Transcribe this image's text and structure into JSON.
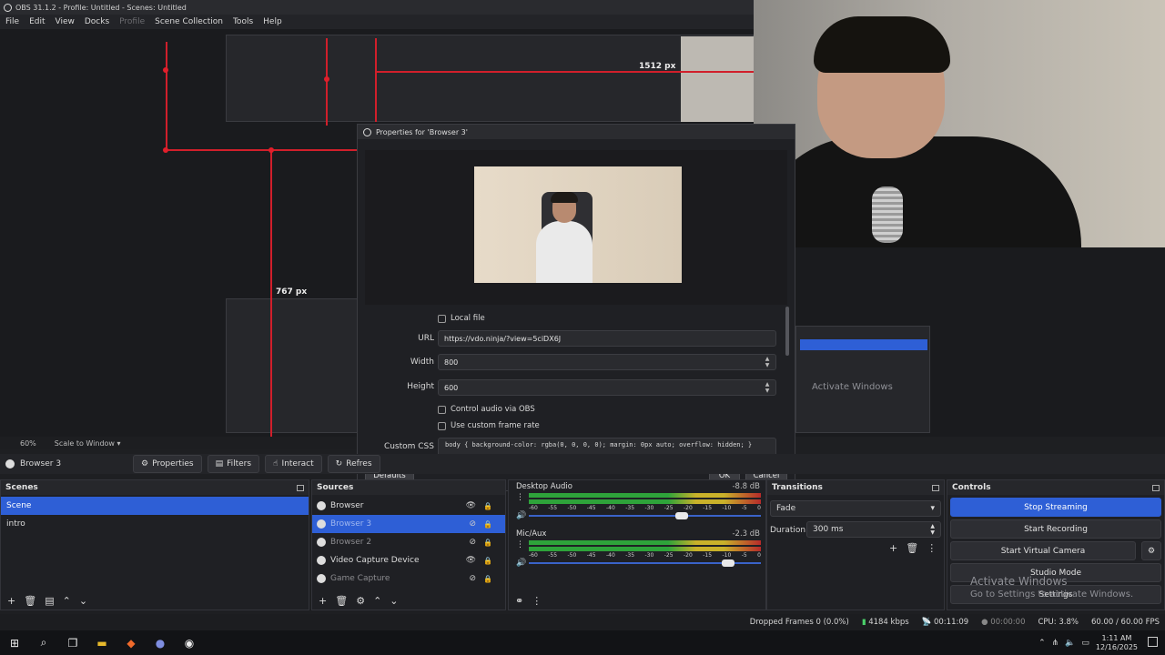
{
  "window": {
    "title": "OBS 31.1.2 - Profile: Untitled - Scenes: Untitled"
  },
  "menu": [
    "File",
    "Edit",
    "View",
    "Docks",
    "Profile",
    "Scene Collection",
    "Tools",
    "Help"
  ],
  "preview": {
    "label_width": "1512 px",
    "label_height": "767 px",
    "zoom": "60%",
    "scale_mode": "Scale to Window"
  },
  "props": {
    "title": "Properties for 'Browser 3'",
    "local_file_label": "Local file",
    "url_label": "URL",
    "url_value": "https://vdo.ninja/?view=5ciDX6J",
    "width_label": "Width",
    "width_value": "800",
    "height_label": "Height",
    "height_value": "600",
    "control_audio_label": "Control audio via OBS",
    "frame_rate_label": "Use custom frame rate",
    "css_label": "Custom CSS",
    "css_value": "body { background-color: rgba(0, 0, 0, 0); margin: 0px auto; overflow: hidden; }",
    "defaults": "Defaults",
    "ok": "OK",
    "cancel": "Cancel"
  },
  "toolbar": {
    "source_name": "Browser 3",
    "properties": "Properties",
    "filters": "Filters",
    "interact": "Interact",
    "refresh": "Refres"
  },
  "scenes": {
    "title": "Scenes",
    "items": [
      "Scene",
      "intro"
    ]
  },
  "sources": {
    "title": "Sources",
    "items": [
      "Browser",
      "Browser 3",
      "Browser 2",
      "Video Capture Device",
      "Game Capture"
    ]
  },
  "mixer": {
    "channels": [
      {
        "name": "Desktop Audio",
        "db": "-8.8 dB",
        "volume": 0.66
      },
      {
        "name": "Mic/Aux",
        "db": "-2.3 dB",
        "volume": 0.86
      }
    ],
    "ticks": [
      "-60",
      "-55",
      "-50",
      "-45",
      "-40",
      "-35",
      "-30",
      "-25",
      "-20",
      "-15",
      "-10",
      "-5",
      "0"
    ]
  },
  "transitions": {
    "title": "Transitions",
    "type": "Fade",
    "duration_label": "Duration",
    "duration_value": "300 ms"
  },
  "controls": {
    "title": "Controls",
    "stop_streaming": "Stop Streaming",
    "start_recording": "Start Recording",
    "start_virtual_camera": "Start Virtual Camera",
    "studio_mode": "Studio Mode",
    "settings": "Settings"
  },
  "watermark": {
    "line1": "Activate Windows",
    "line2": "Go to Settings to activate Windows."
  },
  "status": {
    "dropped": "Dropped Frames 0 (0.0%)",
    "bitrate": "4184 kbps",
    "stream_time": "00:11:09",
    "rec_time": "00:00:00",
    "cpu": "CPU: 3.8%",
    "fps": "60.00 / 60.00 FPS"
  },
  "taskbar": {
    "time": "1:11 AM",
    "date": "12/16/2025"
  },
  "colors": {
    "accent": "#2e5fd6",
    "guide_red": "#d11f2b",
    "meter_green": "#2ea33a",
    "meter_yellow": "#c9b12a",
    "meter_red": "#b72a2a"
  }
}
